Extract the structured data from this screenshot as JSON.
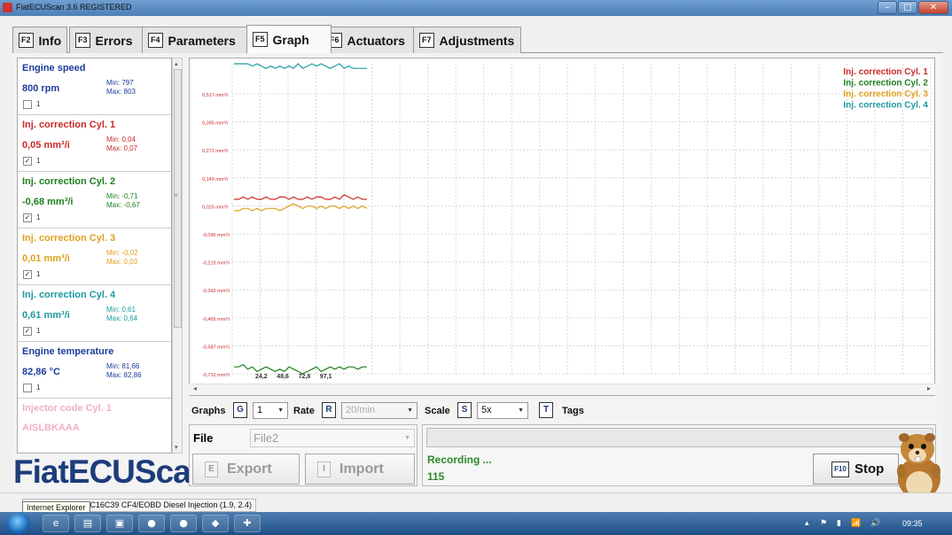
{
  "window": {
    "title": "FiatECUScan 3.6 REGISTERED",
    "min_glyph": "–",
    "max_glyph": "□",
    "close_glyph": "✕"
  },
  "tabs": [
    {
      "key": "F2",
      "label": "Info"
    },
    {
      "key": "F3",
      "label": "Errors"
    },
    {
      "key": "F4",
      "label": "Parameters"
    },
    {
      "key": "F5",
      "label": "Graph",
      "active": true
    },
    {
      "key": "F6",
      "label": "Actuators"
    },
    {
      "key": "F7",
      "label": "Adjustments"
    }
  ],
  "parameters": [
    {
      "name": "Engine speed",
      "value": "800 rpm",
      "min": "Min: 797",
      "max": "Max: 803",
      "checked": "",
      "index": "1",
      "color": "#1d3c9a"
    },
    {
      "name": "Inj. correction Cyl. 1",
      "value": "0,05 mm³/i",
      "min": "Min: 0,04",
      "max": "Max: 0,07",
      "checked": "✓",
      "index": "1",
      "color": "#cc2a2a"
    },
    {
      "name": "Inj. correction Cyl. 2",
      "value": "-0,68 mm³/i",
      "min": "Min: -0,71",
      "max": "Max: -0,67",
      "checked": "✓",
      "index": "1",
      "color": "#1f7f1f"
    },
    {
      "name": "Inj. correction Cyl. 3",
      "value": "0,01 mm³/i",
      "min": "Min: -0,02",
      "max": "Max: 0,03",
      "checked": "✓",
      "index": "1",
      "color": "#e0a020"
    },
    {
      "name": "Inj. correction Cyl. 4",
      "value": "0,61 mm³/i",
      "min": "Min: 0,61",
      "max": "Max: 0,64",
      "checked": "✓",
      "index": "1",
      "color": "#1c9aa0"
    },
    {
      "name": "Engine temperature",
      "value": "82,86 °C",
      "min": "Min: 81,66",
      "max": "Max: 82,86",
      "checked": "",
      "index": "1",
      "color": "#1d3c9a"
    },
    {
      "name": "Injector code Cyl. 1",
      "value": "AISLBKAAA",
      "min": "",
      "max": "",
      "checked": "",
      "index": "",
      "color": "#f0b0c0"
    }
  ],
  "logo": "FiatECUScan",
  "chart_data": {
    "type": "line",
    "title": "",
    "xlabel": "",
    "ylabel": "",
    "y_ticks": [
      "0,517 mm³/i",
      "0,395 mm³/i",
      "0,272 mm³/i",
      "0,149 mm³/i",
      "0,026 mm³/i",
      "-0,096 mm³/i",
      "-0,219 mm³/i",
      "-0,342 mm³/i",
      "-0,465 mm³/i",
      "-0,587 mm³/i",
      "-0,710 mm³/i"
    ],
    "x_ticks": [
      "24,2",
      "48,6",
      "72,8",
      "97,1"
    ],
    "ylim": [
      -0.71,
      0.64
    ],
    "legend_position": "top-right",
    "grid": true,
    "series": [
      {
        "name": "Inj. correction Cyl. 1",
        "color": "#cc2a2a",
        "values": [
          0.05,
          0.05,
          0.06,
          0.05,
          0.06,
          0.05,
          0.05,
          0.06,
          0.05,
          0.05,
          0.06,
          0.06,
          0.05,
          0.06,
          0.05,
          0.05,
          0.06,
          0.05,
          0.06,
          0.06,
          0.05,
          0.05,
          0.06,
          0.05,
          0.07,
          0.06,
          0.05,
          0.06,
          0.05,
          0.05
        ]
      },
      {
        "name": "Inj. correction Cyl. 2",
        "color": "#1f7f1f",
        "values": [
          -0.68,
          -0.68,
          -0.67,
          -0.69,
          -0.68,
          -0.7,
          -0.69,
          -0.68,
          -0.69,
          -0.7,
          -0.69,
          -0.7,
          -0.68,
          -0.69,
          -0.7,
          -0.71,
          -0.7,
          -0.69,
          -0.68,
          -0.7,
          -0.69,
          -0.68,
          -0.69,
          -0.68,
          -0.69,
          -0.68,
          -0.68,
          -0.69,
          -0.68,
          -0.68
        ]
      },
      {
        "name": "Inj. correction Cyl. 3",
        "color": "#e0a020",
        "values": [
          0.0,
          0.0,
          0.01,
          0.01,
          0.0,
          0.01,
          0.0,
          0.01,
          0.01,
          0.01,
          0.0,
          0.01,
          0.02,
          0.03,
          0.02,
          0.01,
          0.02,
          0.02,
          0.01,
          0.02,
          0.01,
          0.02,
          0.02,
          0.01,
          0.02,
          0.01,
          0.02,
          0.01,
          0.02,
          0.01
        ]
      },
      {
        "name": "Inj. correction Cyl. 4",
        "color": "#1c9aa0",
        "values": [
          0.64,
          0.64,
          0.64,
          0.64,
          0.63,
          0.64,
          0.63,
          0.62,
          0.63,
          0.62,
          0.63,
          0.62,
          0.63,
          0.62,
          0.64,
          0.62,
          0.63,
          0.64,
          0.63,
          0.64,
          0.63,
          0.62,
          0.63,
          0.64,
          0.62,
          0.63,
          0.62,
          0.62,
          0.62,
          0.62
        ]
      }
    ]
  },
  "scroll": {
    "left": "◂",
    "right": "▸",
    "up": "▴",
    "down": "▾",
    "grip": "≡"
  },
  "controls": {
    "graphs_label": "Graphs",
    "graphs_key": "G",
    "graphs_value": "1",
    "rate_label": "Rate",
    "rate_key": "R",
    "rate_value": "20/min",
    "scale_label": "Scale",
    "scale_key": "S",
    "scale_value": "5x",
    "tags_key": "T",
    "tags_label": "Tags",
    "arrow": "▼"
  },
  "file": {
    "label": "File",
    "value": "File2"
  },
  "export": {
    "key": "E",
    "label": "Export"
  },
  "import": {
    "key": "I",
    "label": "Import"
  },
  "recording": {
    "status": "Recording ...",
    "count": "115"
  },
  "stop": {
    "key": "F10",
    "label": "Stop"
  },
  "statusbar": {
    "text": "T 16V / Bosch EDC16C39 CF4/EOBD Diesel Injection (1.9, 2.4)",
    "tooltip": "Internet Explorer"
  },
  "taskbar": {
    "clock": "09:35",
    "tray": [
      "▴",
      "⚑",
      "▮",
      "📶",
      "🔊"
    ],
    "icons": [
      "e",
      "▤",
      "▣",
      "●",
      "●",
      "◆",
      "✚"
    ]
  }
}
